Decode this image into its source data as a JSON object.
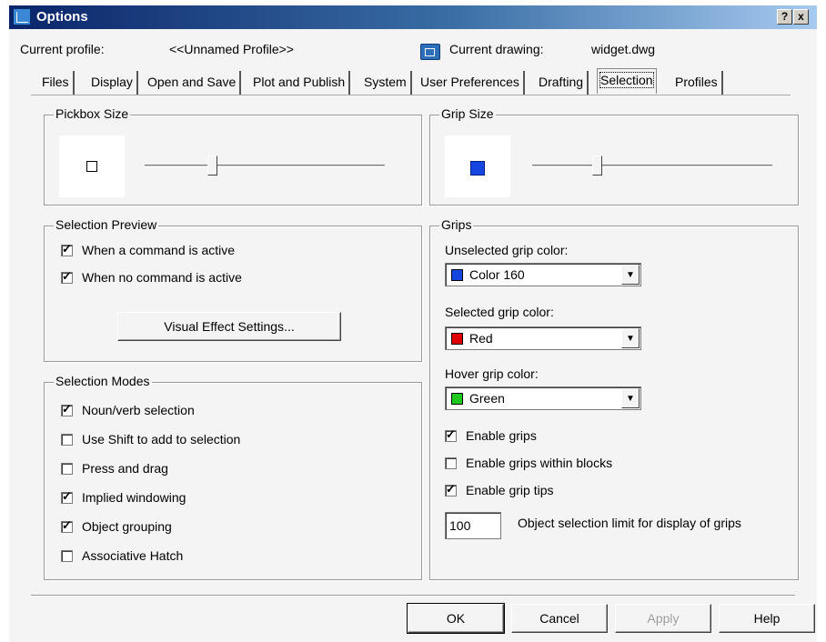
{
  "window": {
    "title": "Options",
    "help_label": "?",
    "close_label": "x"
  },
  "profile": {
    "current_profile_label": "Current profile:",
    "current_profile_value": "<<Unnamed Profile>>",
    "current_drawing_label": "Current drawing:",
    "current_drawing_value": "widget.dwg"
  },
  "tabs": [
    {
      "label": "Files"
    },
    {
      "label": "Display"
    },
    {
      "label": "Open and Save"
    },
    {
      "label": "Plot and Publish"
    },
    {
      "label": "System"
    },
    {
      "label": "User Preferences"
    },
    {
      "label": "Drafting"
    },
    {
      "label": "Selection",
      "active": true
    },
    {
      "label": "Profiles"
    }
  ],
  "pickbox": {
    "title": "Pickbox Size",
    "slider_fraction": 0.28
  },
  "grip_size": {
    "title": "Grip Size",
    "slider_fraction": 0.27
  },
  "selection_preview": {
    "title": "Selection Preview",
    "items": [
      {
        "label": "When a command is active",
        "checked": true
      },
      {
        "label": "When no command is active",
        "checked": true
      }
    ],
    "visual_effect_button": "Visual Effect Settings..."
  },
  "selection_modes": {
    "title": "Selection Modes",
    "items": [
      {
        "label": "Noun/verb selection",
        "checked": true
      },
      {
        "label": "Use Shift to add to selection",
        "checked": false
      },
      {
        "label": "Press and drag",
        "checked": false
      },
      {
        "label": "Implied windowing",
        "checked": true
      },
      {
        "label": "Object grouping",
        "checked": true
      },
      {
        "label": "Associative Hatch",
        "checked": false
      }
    ]
  },
  "grips": {
    "title": "Grips",
    "unselected_label": "Unselected grip color:",
    "unselected_value": "Color 160",
    "unselected_color": "#1646e0",
    "selected_label": "Selected grip color:",
    "selected_value": "Red",
    "selected_color": "#e00000",
    "hover_label": "Hover grip color:",
    "hover_value": "Green",
    "hover_color": "#1ec81e",
    "items": [
      {
        "label": "Enable grips",
        "checked": true
      },
      {
        "label": "Enable grips within blocks",
        "checked": false
      },
      {
        "label": "Enable grip tips",
        "checked": true
      }
    ],
    "limit_value": "100",
    "limit_label": "Object selection limit for display of grips"
  },
  "buttons": {
    "ok": "OK",
    "cancel": "Cancel",
    "apply": "Apply",
    "help": "Help"
  }
}
